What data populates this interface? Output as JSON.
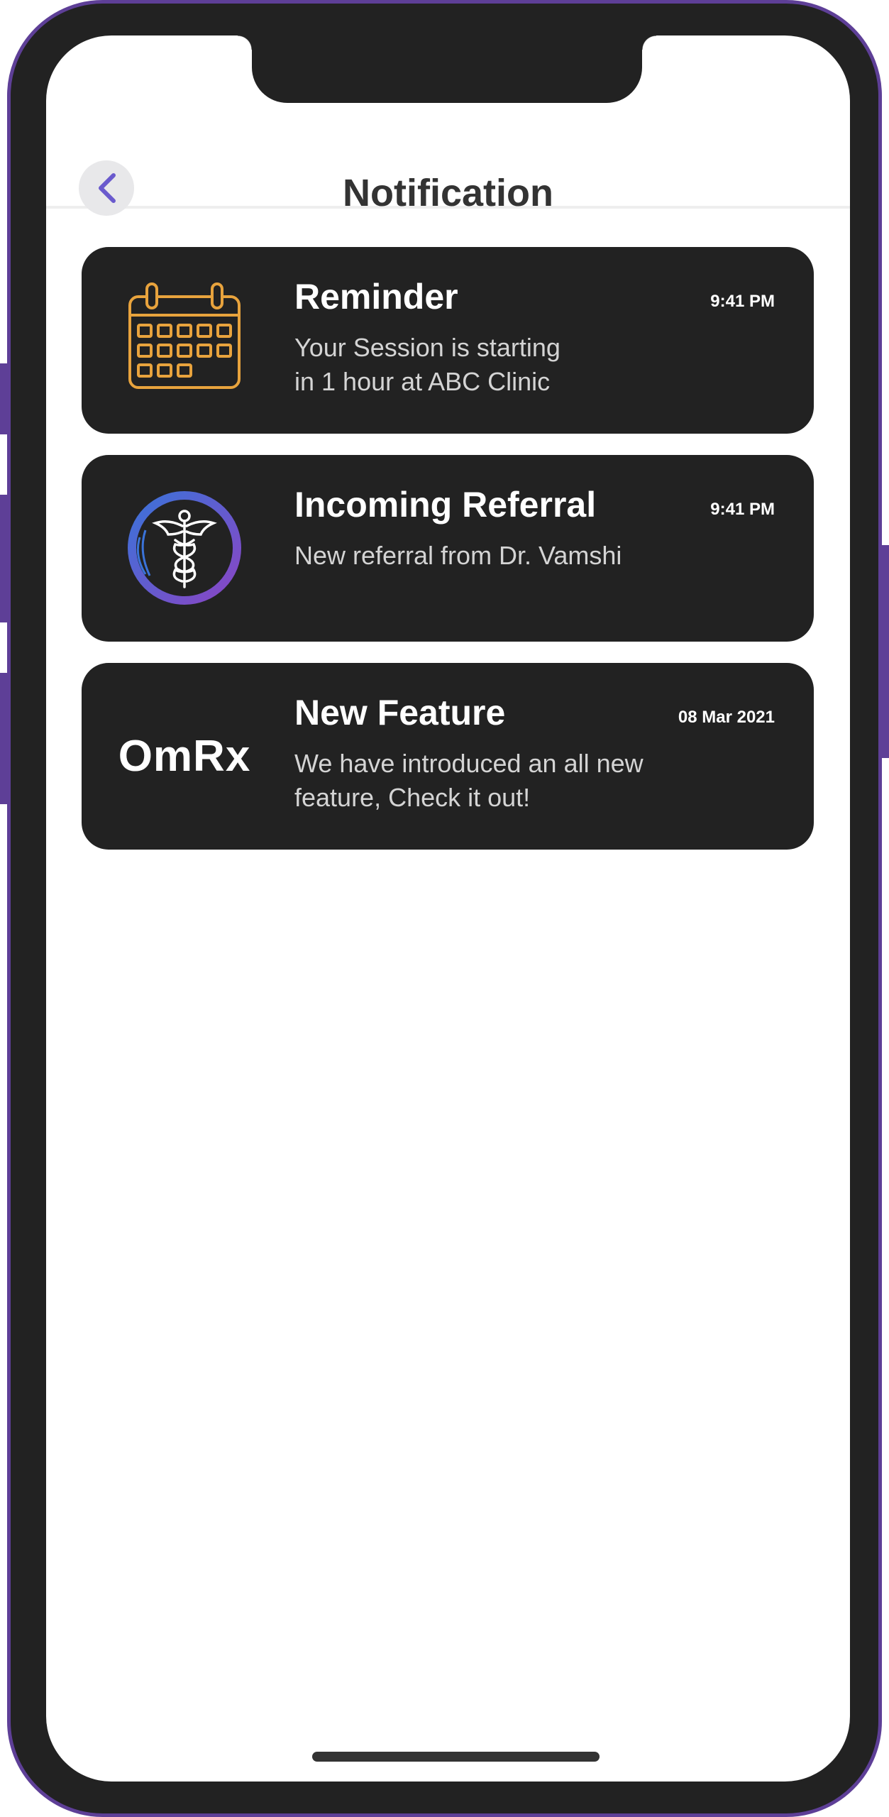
{
  "header": {
    "title": "Notification",
    "back_icon": "chevron-left-icon"
  },
  "colors": {
    "frame_border": "#5e3f97",
    "card_bg": "#222222",
    "calendar_icon": "#e8a33d",
    "caduceus_gradient_start": "#3a73d9",
    "caduceus_gradient_end": "#8a45c4",
    "back_chevron": "#6a5acd"
  },
  "notifications": [
    {
      "icon": "calendar-icon",
      "title": "Reminder",
      "time": "9:41 PM",
      "message_lines": [
        "Your Session is starting",
        "in 1 hour at ABC Clinic"
      ]
    },
    {
      "icon": "caduceus-icon",
      "title": "Incoming Referral",
      "time": "9:41 PM",
      "message_lines": [
        "New referral from Dr. Vamshi"
      ]
    },
    {
      "icon": "omrx-logo",
      "logo_text": "OmRx",
      "title": "New Feature",
      "time": "08 Mar 2021",
      "message_lines": [
        "We have introduced an all new",
        "feature, Check it out!"
      ]
    }
  ]
}
